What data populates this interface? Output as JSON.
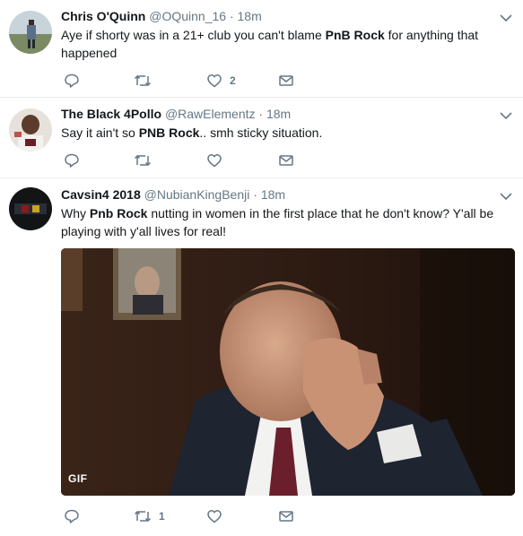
{
  "tweets": [
    {
      "name": "Chris O'Quinn",
      "handle": "@OQuinn_16",
      "dot": "·",
      "time": "18m",
      "text_parts": [
        "Aye if shorty was in a 21+ club you can't blame ",
        "PnB Rock",
        " for anything that happened"
      ],
      "reply_count": "",
      "retweet_count": "",
      "like_count": "2"
    },
    {
      "name": "The Black 4Pollo",
      "handle": "@RawElementz",
      "dot": "·",
      "time": "18m",
      "text_parts": [
        "Say it ain't so ",
        "PNB Rock",
        ".. smh sticky situation."
      ],
      "reply_count": "",
      "retweet_count": "",
      "like_count": ""
    },
    {
      "name": "Cavsin4 2018",
      "handle": "@NubianKingBenji",
      "dot": "·",
      "time": "18m",
      "text_parts": [
        "Why ",
        "Pnb Rock",
        " nutting in women in the first place that he don't know? Y'all be playing with y'all lives for real!"
      ],
      "reply_count": "",
      "retweet_count": "1",
      "like_count": "",
      "media_badge": "GIF"
    }
  ],
  "colors": {
    "text": "#14171a",
    "secondary": "#657786",
    "divider": "#e6ecf0"
  },
  "icons": [
    "reply-icon",
    "retweet-icon",
    "like-icon",
    "direct-message-icon",
    "chevron-down-icon"
  ]
}
